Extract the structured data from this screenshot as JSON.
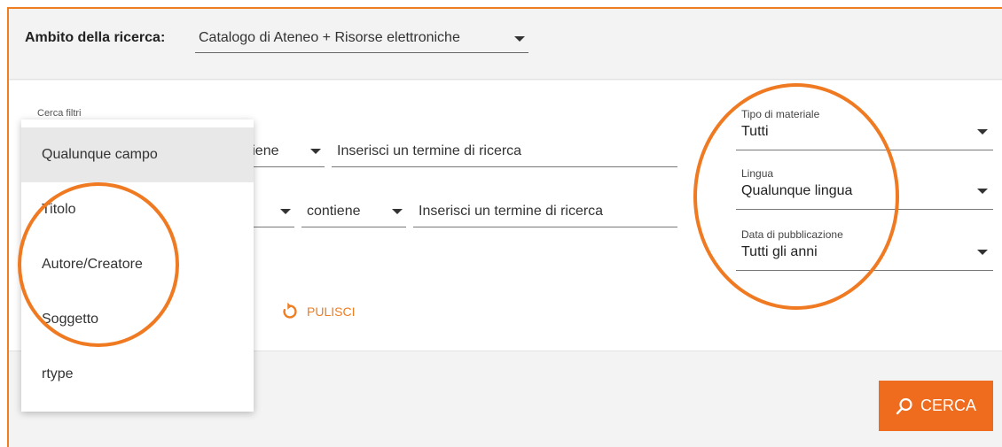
{
  "scope": {
    "label": "Ambito della ricerca:",
    "value": "Catalogo di Ateneo + Risorse elettroniche"
  },
  "search": {
    "filters_label": "Cerca filtri",
    "row1": {
      "operator": "contiene",
      "placeholder": "Inserisci un termine di ricerca"
    },
    "row2": {
      "field": "",
      "operator": "contiene",
      "placeholder": "Inserisci un termine di ricerca"
    },
    "clear_label": "PULISCI"
  },
  "field_menu": {
    "items": [
      "Qualunque campo",
      "Titolo",
      "Autore/Creatore",
      "Soggetto",
      "rtype"
    ],
    "selected": "Qualunque campo"
  },
  "facets": [
    {
      "label": "Tipo di materiale",
      "value": "Tutti"
    },
    {
      "label": "Lingua",
      "value": "Qualunque lingua"
    },
    {
      "label": "Data di pubblicazione",
      "value": "Tutti gli anni"
    }
  ],
  "search_button": {
    "label": "CERCA",
    "icon": "search-icon"
  },
  "colors": {
    "accent": "#ef7d22",
    "button": "#ef6b1d",
    "annotation": "#f07a22"
  }
}
